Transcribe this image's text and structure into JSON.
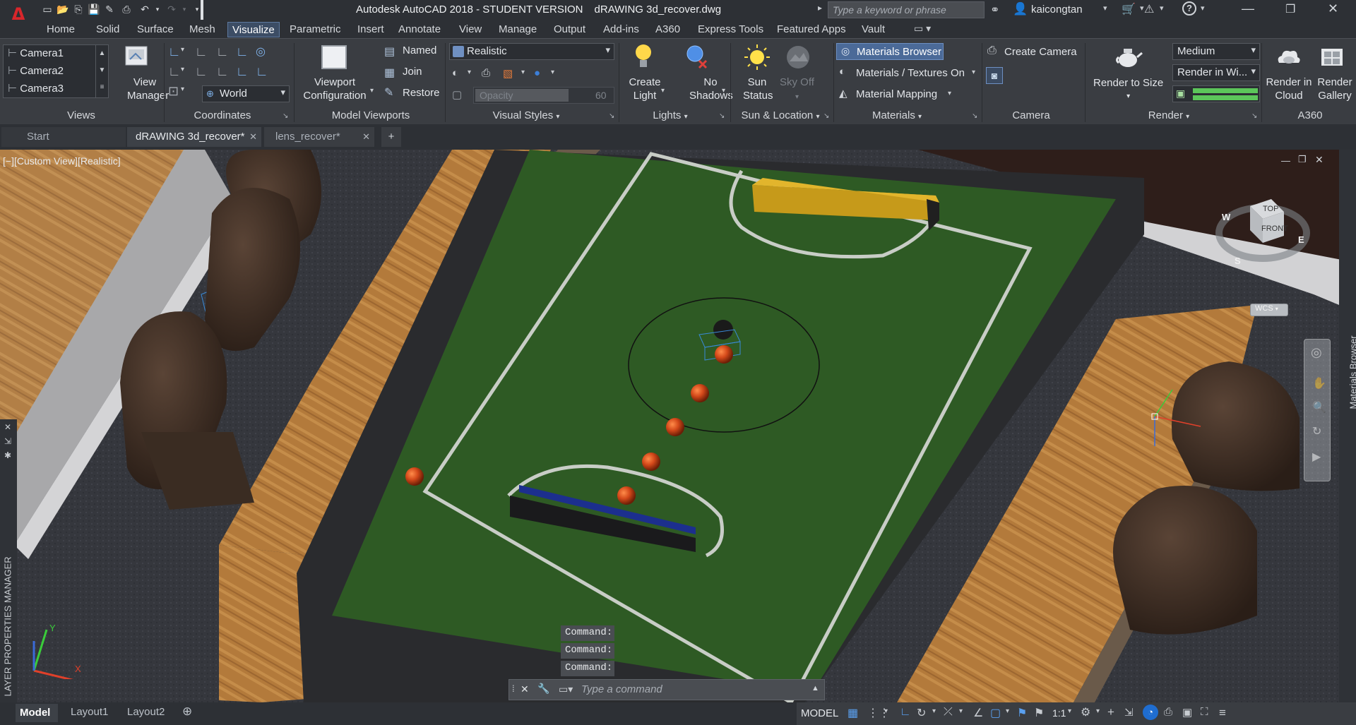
{
  "app": {
    "title": "Autodesk AutoCAD 2018 - STUDENT VERSION",
    "filename": "dRAWING 3d_recover.dwg",
    "search_placeholder": "Type a keyword or phrase",
    "username": "kaicongtan"
  },
  "ribbon_tabs": [
    "Home",
    "Solid",
    "Surface",
    "Mesh",
    "Visualize",
    "Parametric",
    "Insert",
    "Annotate",
    "View",
    "Manage",
    "Output",
    "Add-ins",
    "A360",
    "Express Tools",
    "Featured Apps",
    "Vault"
  ],
  "active_tab": "Visualize",
  "views_panel": {
    "cameras": [
      "Camera1",
      "Camera2",
      "Camera3"
    ],
    "view_manager": "View Manager",
    "title": "Views"
  },
  "coordinates_panel": {
    "ucs": "World",
    "title": "Coordinates"
  },
  "model_viewports_panel": {
    "viewport_config": "Viewport Configuration",
    "named": "Named",
    "join": "Join",
    "restore": "Restore",
    "title": "Model Viewports"
  },
  "visual_styles_panel": {
    "style": "Realistic",
    "opacity_label": "Opacity",
    "opacity_value": "60",
    "title": "Visual Styles"
  },
  "lights_panel": {
    "create_light": "Create Light",
    "no_shadows": "No Shadows",
    "title": "Lights"
  },
  "sun_panel": {
    "sun_status": "Sun Status",
    "sky_off": "Sky Off",
    "title": "Sun & Location"
  },
  "materials_panel": {
    "browser": "Materials Browser",
    "textures": "Materials / Textures On",
    "mapping": "Material Mapping",
    "title": "Materials"
  },
  "camera_panel": {
    "create_camera": "Create Camera",
    "title": "Camera"
  },
  "render_panel": {
    "render_to_size": "Render to Size",
    "quality": "Medium",
    "render_in": "Render in Wi...",
    "title": "Render"
  },
  "a360_panel": {
    "render_in_cloud": "Render in Cloud",
    "render_gallery": "Render Gallery",
    "title": "A360"
  },
  "doc_tabs": [
    "Start",
    "dRAWING 3d_recover*",
    "lens_recover*"
  ],
  "viewport": {
    "label": "[−][Custom View][Realistic]",
    "viewcube_top": "TOP",
    "viewcube_front": "FRONT",
    "compass_w": "W",
    "compass_s": "S",
    "compass_e": "E",
    "wcs": "WCS",
    "materials_browser_palette": "Materials Browser",
    "layer_manager_palette": "LAYER PROPERTIES MANAGER",
    "axis_x": "X",
    "axis_y": "Y"
  },
  "command": {
    "history": [
      "Command:",
      "Command:",
      "Command:"
    ],
    "placeholder": "Type a command"
  },
  "layout_tabs": [
    "Model",
    "Layout1",
    "Layout2"
  ],
  "status": {
    "model": "MODEL",
    "scale": "1:1"
  }
}
